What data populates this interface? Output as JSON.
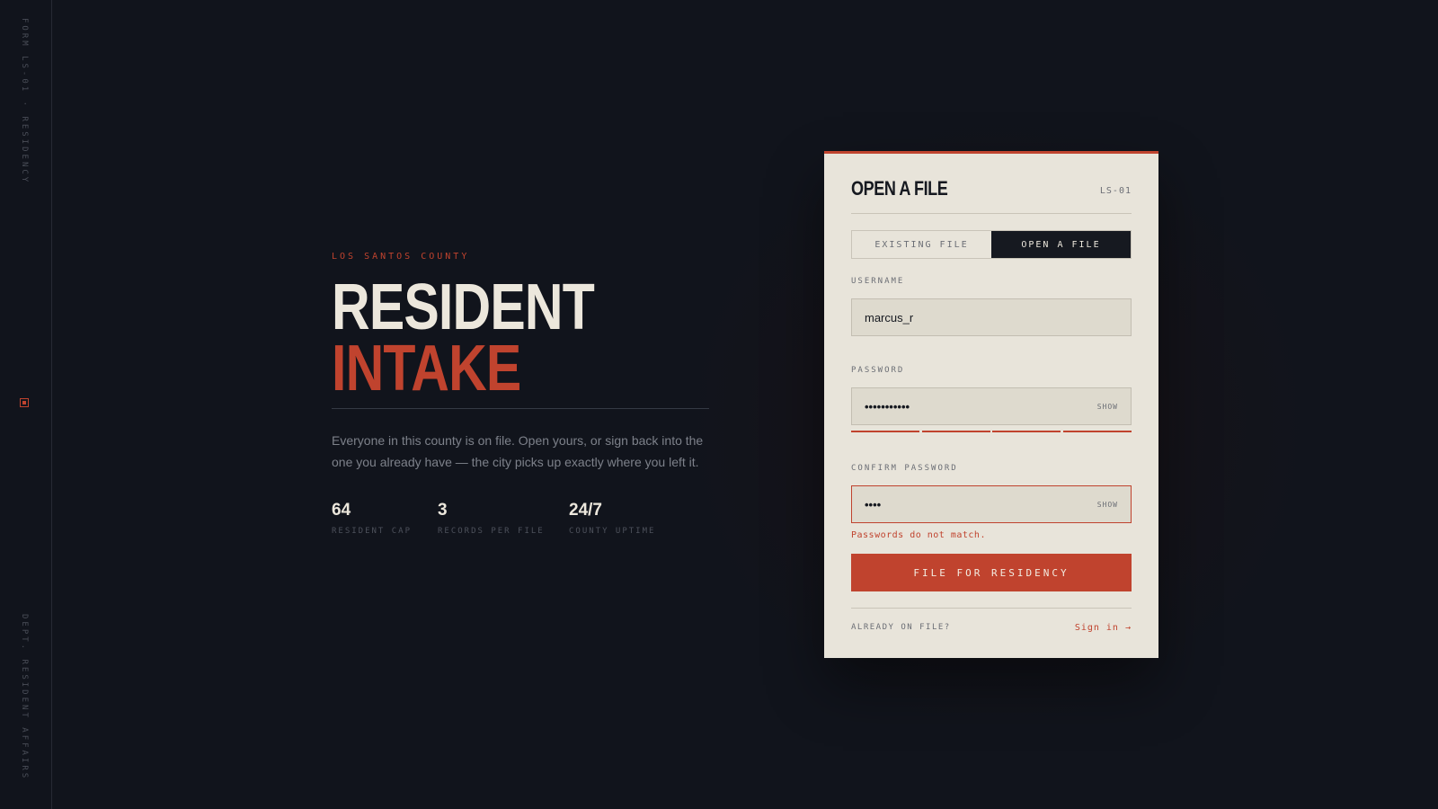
{
  "rail": {
    "top_text": "FORM LS-01 · RESIDENCY",
    "bottom_text": "DEPT. RESIDENT AFFAIRS"
  },
  "hero": {
    "eyebrow": "LOS SANTOS COUNTY",
    "title_line1": "RESIDENT",
    "title_line2": "INTAKE",
    "description": "Everyone in this county is on file. Open yours, or sign back into the one you already have — the city picks up exactly where you left it.",
    "stats": [
      {
        "value": "64",
        "label": "RESIDENT CAP"
      },
      {
        "value": "3",
        "label": "RECORDS PER FILE"
      },
      {
        "value": "24/7",
        "label": "COUNTY UPTIME"
      }
    ]
  },
  "card": {
    "title": "OPEN A FILE",
    "code": "LS-01",
    "tabs": [
      {
        "label": "EXISTING FILE",
        "active": false
      },
      {
        "label": "OPEN A FILE",
        "active": true
      }
    ],
    "username": {
      "label": "USERNAME",
      "value": "marcus_r"
    },
    "password": {
      "label": "PASSWORD",
      "value": "•••••••••••",
      "toggle": "SHOW",
      "strength_segments": 4
    },
    "confirm": {
      "label": "CONFIRM PASSWORD",
      "value": "••••",
      "toggle": "SHOW",
      "error": "Passwords do not match."
    },
    "submit_label": "FILE FOR RESIDENCY",
    "footer_question": "ALREADY ON FILE?",
    "footer_link": "Sign in →"
  },
  "colors": {
    "background": "#11141c",
    "accent": "#c0432e",
    "card": "#e8e4da",
    "ink": "#161920"
  }
}
